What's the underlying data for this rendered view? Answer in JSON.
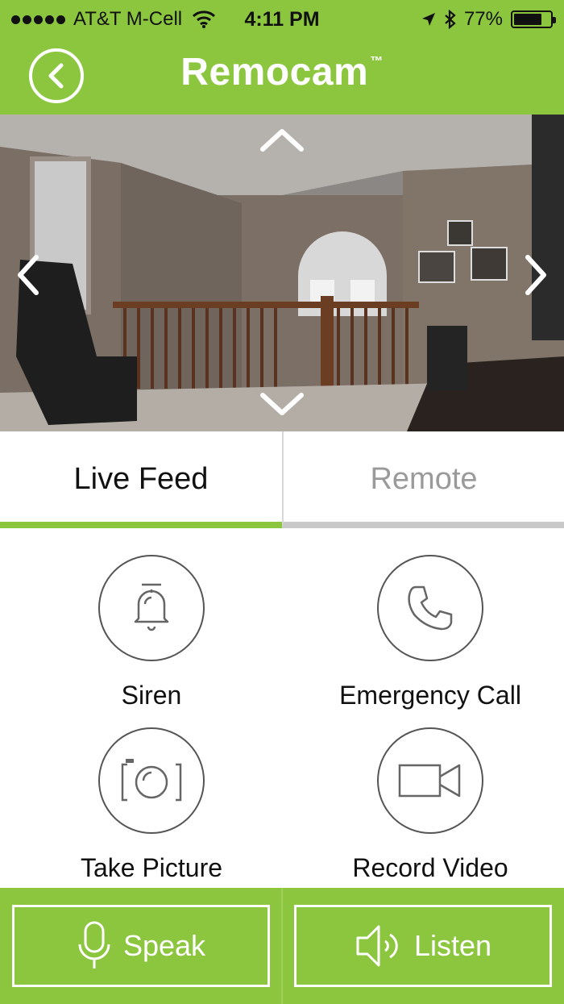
{
  "status_bar": {
    "carrier": "AT&T M-Cell",
    "time": "4:11 PM",
    "battery_percent_text": "77%",
    "battery_level": 0.77
  },
  "header": {
    "title": "Remocam",
    "trademark": "™"
  },
  "tabs": [
    {
      "label": "Live Feed",
      "active": true
    },
    {
      "label": "Remote",
      "active": false
    }
  ],
  "actions": {
    "siren": "Siren",
    "emergency_call": "Emergency Call",
    "take_picture": "Take Picture",
    "record_video": "Record Video"
  },
  "bottom_bar": {
    "speak_label": "Speak",
    "listen_label": "Listen"
  },
  "colors": {
    "accent": "#8cc63f",
    "inactive_tab_text": "#9a9a9a"
  }
}
